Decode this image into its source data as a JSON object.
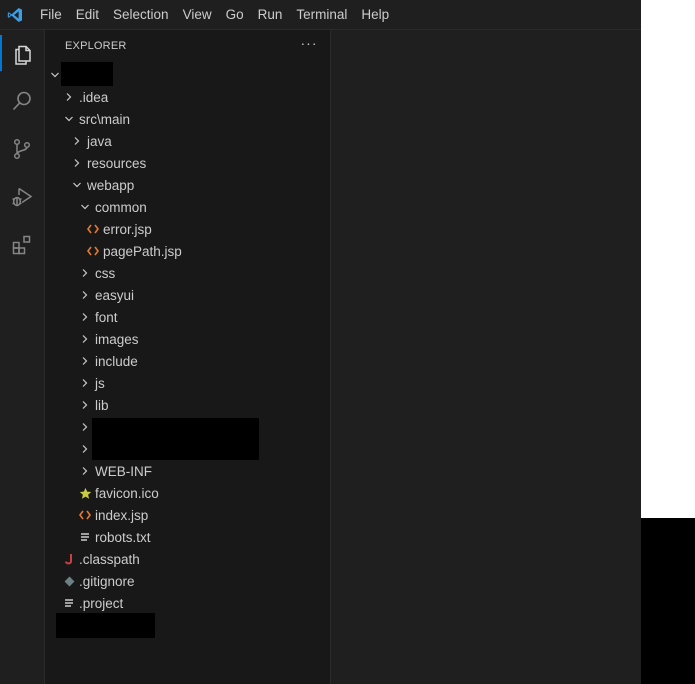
{
  "menubar": {
    "items": [
      "File",
      "Edit",
      "Selection",
      "View",
      "Go",
      "Run",
      "Terminal",
      "Help"
    ]
  },
  "activitybar": {
    "icons": [
      "explorer-icon",
      "search-icon",
      "source-control-icon",
      "run-debug-icon",
      "extensions-icon"
    ],
    "accent_color": "#0078d4"
  },
  "explorer": {
    "title": "EXPLORER",
    "more_label": "···",
    "tree": [
      {
        "label": ".idea",
        "type": "folder",
        "expanded": false
      },
      {
        "label": "src\\main",
        "type": "folder",
        "expanded": true
      },
      {
        "label": "java",
        "type": "folder",
        "expanded": false
      },
      {
        "label": "resources",
        "type": "folder",
        "expanded": false
      },
      {
        "label": "webapp",
        "type": "folder",
        "expanded": true
      },
      {
        "label": "common",
        "type": "folder",
        "expanded": true
      },
      {
        "label": "error.jsp",
        "type": "file",
        "icon": "jsp-file-icon"
      },
      {
        "label": "pagePath.jsp",
        "type": "file",
        "icon": "jsp-file-icon"
      },
      {
        "label": "css",
        "type": "folder",
        "expanded": false
      },
      {
        "label": "easyui",
        "type": "folder",
        "expanded": false
      },
      {
        "label": "font",
        "type": "folder",
        "expanded": false
      },
      {
        "label": "images",
        "type": "folder",
        "expanded": false
      },
      {
        "label": "include",
        "type": "folder",
        "expanded": false
      },
      {
        "label": "js",
        "type": "folder",
        "expanded": false
      },
      {
        "label": "lib",
        "type": "folder",
        "expanded": false
      },
      {
        "label": "WEB-INF",
        "type": "folder",
        "expanded": false
      },
      {
        "label": "favicon.ico",
        "type": "file",
        "icon": "star-icon"
      },
      {
        "label": "index.jsp",
        "type": "file",
        "icon": "jsp-file-icon"
      },
      {
        "label": "robots.txt",
        "type": "file",
        "icon": "text-file-icon"
      },
      {
        "label": ".classpath",
        "type": "file",
        "icon": "java-file-icon"
      },
      {
        "label": ".gitignore",
        "type": "file",
        "icon": "git-file-icon"
      },
      {
        "label": ".project",
        "type": "file",
        "icon": "text-file-icon"
      }
    ]
  },
  "colors": {
    "jsp_icon": "#e37933",
    "star_icon": "#cbcb41",
    "java_icon": "#cc3e44",
    "git_icon": "#6d8086"
  }
}
